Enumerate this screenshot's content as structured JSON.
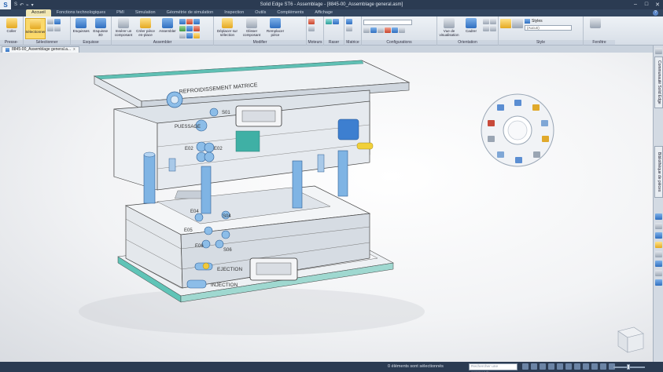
{
  "window": {
    "title": "Solid Edge ST6 - Assemblage - [8845-00_Assemblage general.asm]",
    "quick_access": [
      "S",
      "↶",
      "⌁",
      "▾"
    ],
    "controls": [
      "–",
      "□",
      "✕"
    ]
  },
  "ribbon_tabs": [
    "Accueil",
    "Fonctions technologiques",
    "PMI",
    "Simulation",
    "Géométrie de simulation",
    "Inspection",
    "Outils",
    "Compléments",
    "Affichage"
  ],
  "active_tab": "Accueil",
  "ribbon_groups": [
    {
      "label": "Presse-papiers",
      "buttons": [
        "Coller"
      ]
    },
    {
      "label": "Sélectionner",
      "buttons": [
        "Sélectionner"
      ]
    },
    {
      "label": "Esquisse",
      "buttons": [
        "Esquisses",
        "Esquisse 3D"
      ]
    },
    {
      "label": "Assembler",
      "buttons": [
        "Insérer un composant",
        "Créer pièce en-place",
        "Assembler"
      ]
    },
    {
      "label": "Modifier",
      "buttons": [
        "Déplacer sur sélection",
        "Glisser composant",
        "Remplacer pièce"
      ]
    },
    {
      "label": "Moteurs",
      "buttons": []
    },
    {
      "label": "Raser faces",
      "buttons": []
    },
    {
      "label": "Matrice",
      "buttons": []
    },
    {
      "label": "Configurations",
      "buttons": []
    },
    {
      "label": "Orientation",
      "buttons": [
        "Vue de visualisation",
        "Cadrer"
      ]
    },
    {
      "label": "Style",
      "buttons": []
    },
    {
      "label": "Fenêtre",
      "buttons": []
    }
  ],
  "style_group": {
    "label": "Styles",
    "value": "(Aucun)"
  },
  "document_tab": {
    "label": "8845-00_Assemblage general.a...",
    "close": "x"
  },
  "model_labels": [
    "REFROIDISSEMENT MATRICE",
    "S01",
    "PUESSAGE",
    "E02",
    "E02",
    "E04",
    "S04",
    "E05",
    "E06",
    "S06",
    "EJECTION",
    "INJECTION"
  ],
  "dock_tabs": [
    "Communauté Solid Edge",
    "Bibliothèque de pièces"
  ],
  "status": {
    "message": "0 éléments sont sélectionnés",
    "search_placeholder": "Rechercher une commande"
  },
  "colors": {
    "chrome": "#2b3b52",
    "active_tab": "#f1e7b4",
    "selected_button": "#fbd96b",
    "cooling_blue": "#6ea6d8",
    "plate_teal": "#5fc0b4"
  }
}
